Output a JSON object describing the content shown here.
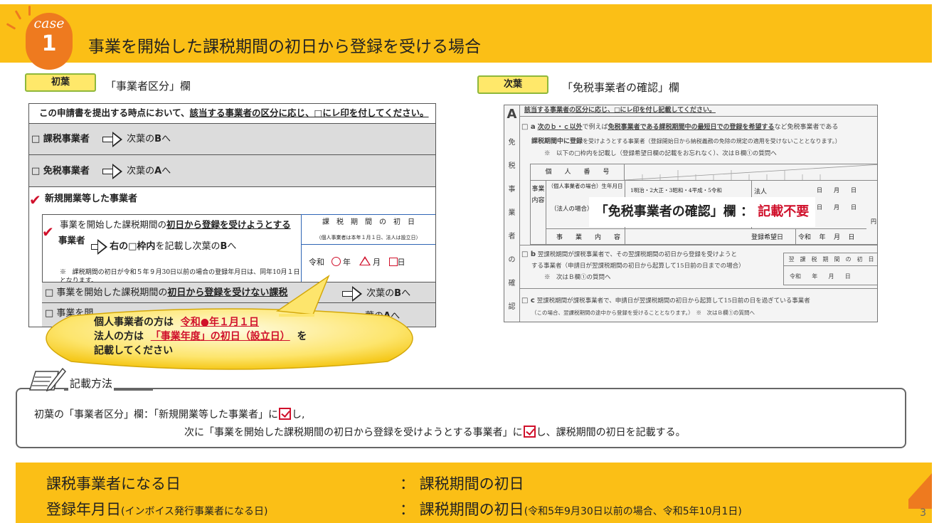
{
  "header": {
    "case_word": "case",
    "case_number": "1",
    "title": "事業を開始した課税期間の初日から登録を受ける場合"
  },
  "left_section": {
    "tag": "初葉",
    "label": "「事業者区分」欄",
    "form": {
      "heading_prefix": "この申請書を提出する時点において、",
      "heading_underlined": "該当する事業者の区分に応じ、□にレ印を付してください。",
      "row1_label": "□ 課税事業者",
      "row1_dest": "次葉の",
      "row1_dest_bold": "B",
      "row1_dest_suffix": "へ",
      "row2_label": "□ 免税事業者",
      "row2_dest": "次葉の",
      "row2_dest_bold": "A",
      "row2_dest_suffix": "へ",
      "row3_label": "新規開業等した事業者",
      "sub1_prefix": "事業を開始した課税期間の",
      "sub1_underlined": "初日から登録を受けようとする",
      "sub1_cont": "事業者",
      "sub1_dest_bold": "右の□枠内",
      "sub1_dest": "を記載し次葉の",
      "sub1_dest_b": "B",
      "sub1_dest_suffix": "へ",
      "note_mark": "※",
      "note_text": "課税期間の初日が令和５年９月30日以前の場合の登録年月日は、同年10月１日となります。",
      "box_title": "課　税　期　間　の　初　日",
      "box_note": "（個人事業者は本年１月１日、法人は設立日）",
      "box_era": "令和",
      "box_year": "年",
      "box_month": "月",
      "box_day": "日",
      "sub2_prefix": "□ 事業を開始した課税期間の",
      "sub2_underlined": "初日から登録を受けない課税",
      "sub2_dest": "次葉の",
      "sub2_dest_bold": "B",
      "sub2_dest_suffix": "へ",
      "sub3_prefix": "□ 事業を開",
      "sub3_dest": "葉の",
      "sub3_dest_bold": "A",
      "sub3_dest_suffix": "へ"
    },
    "callout": {
      "line1_prefix": "個人事業者の方は",
      "line1_red": "令和●年１月１日",
      "line2_prefix": "法人の方は",
      "line2_red": "「事業年度」の初日（設立日）",
      "line2_suffix": "を",
      "line3": "記載してください"
    }
  },
  "right_section": {
    "tag": "次葉",
    "label": "「免税事業者の確認」欄",
    "form": {
      "side_letter": "A",
      "side_text": [
        "免",
        "税",
        "事",
        "業",
        "者",
        "の",
        "確",
        "認"
      ],
      "header": "該当する事業者の区分に応じ、□にレ印を付し記載してください。",
      "a_line1_prefix": "□ a",
      "a_line1_u": "次のｂ・ｃ以外",
      "a_line1_mid": "で例えば",
      "a_line1_u2": "免税事業者である課税期間中の最短日での登録を希望する",
      "a_line1_suffix": "など免税事業者である",
      "a_line2_bold": "課税期間中に登録",
      "a_line2": "を受けようとする事業者（登録開始日から納税義務の免除の規定の適用を受けないこととなります。）",
      "a_line3": "※　以下の□枠内を記載し（登録希望日欄の記載をお忘れなく）、次はＢ欄①の質問へ",
      "id_label": "個　　人　　番　　号",
      "biz_label1": "事業内容",
      "biz_birth": "（個人事業者の場合）生年月日",
      "biz_era": "1明治・2大正・3昭和・4平成・5令和",
      "biz_corp": "（法人の場合）設立年月日",
      "biz_kind": "事　　業　　内　　容",
      "biz_houjin": "法人",
      "date_hint": "日　　月　　日",
      "yen": "円",
      "reg_label": "登録希望日",
      "reg_era": "令和",
      "reg_year": "年",
      "reg_month": "月",
      "reg_day": "日",
      "b_prefix": "□ b",
      "b_line1": "翌課税期間が課税事業者で、その翌課税期間の初日から登録を受けようと",
      "b_line2": "する事業者（申請日が翌課税期間の初日から起算して15日前の日までの場合）",
      "b_line3": "※　次はＢ欄①の質問へ",
      "b_box": "翌　課　税　期　間　の　初　日",
      "b_box_era": "令和",
      "b_box_year": "年",
      "b_box_month": "月",
      "b_box_day": "日",
      "c_prefix": "□ c",
      "c_line1": "翌課税期間が課税事業者で、申請日が翌課税期間の初日から起算して15日前の日を過ぎている事業者",
      "c_line2": "（この場合、翌課税期間の途中から登録を受けることとなります。）　※　次はＢ欄①の質問へ"
    },
    "overlay_label": "「免税事業者の確認」欄 ：",
    "overlay_red": "記載不要"
  },
  "method": {
    "title": "記載方法",
    "line1_prefix": "初葉の「事業者区分」欄：「新規開業等した事業者」に",
    "line1_suffix": "し,",
    "line2_prefix": "次に「事業を開始した課税期間の初日から登録を受けようとする事業者」に",
    "line2_suffix": "し、課税期間の初日を記載する。"
  },
  "footer": {
    "row1_left": "課税事業者になる日",
    "row1_right": "：  課税期間の初日",
    "row2_left": "登録年月日",
    "row2_left_small": "(インボイス発行事業者になる日)",
    "row2_right": "：  課税期間の初日",
    "row2_right_small": "(令和5年9月30日以前の場合、令和5年10月1日)"
  },
  "page_number": "3",
  "colors": {
    "accent": "#fbbf16",
    "orange": "#ee7a1f",
    "red": "#d0102b",
    "tag_fill": "#ffe86a",
    "tag_border": "#8fb83a",
    "box_blue": "#2f65b5"
  }
}
